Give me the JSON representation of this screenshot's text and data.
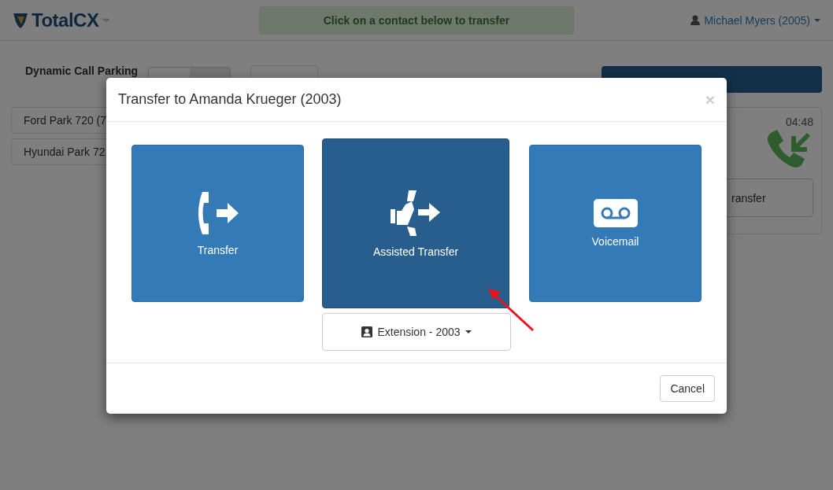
{
  "header": {
    "logo": "TotalCX",
    "logo_mark": "™",
    "alert": "Click on a contact below to transfer",
    "user": "Michael Myers (2005)"
  },
  "toolbar": {
    "label": "Dynamic Call Parking",
    "parking_on": false
  },
  "parking": [
    {
      "name": "Ford Park 720 (7"
    },
    {
      "name": "Hyundai Park 72"
    }
  ],
  "call_card": {
    "timer": "04:48",
    "button": "ransfer"
  },
  "modal": {
    "title": "Transfer to Amanda Krueger (2003)",
    "close": "×",
    "options": [
      {
        "kind": "transfer",
        "label": "Transfer",
        "selected": false
      },
      {
        "kind": "assisted",
        "label": "Assisted Transfer",
        "selected": true
      },
      {
        "kind": "voicemail",
        "label": "Voicemail",
        "selected": false
      }
    ],
    "target": "Extension - 2003",
    "cancel": "Cancel"
  }
}
